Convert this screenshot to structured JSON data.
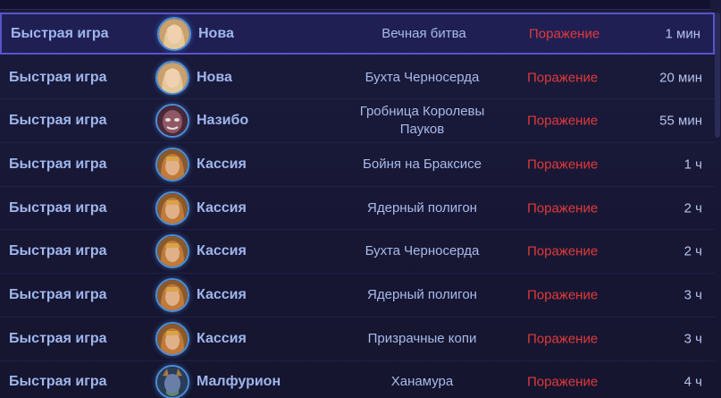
{
  "history": [
    {
      "mode": "Быстрая игра",
      "hero": "Нова",
      "hero_icon": "nova-portrait-icon",
      "map_line1": "Вечная битва",
      "map_line2": "",
      "result": "Поражение",
      "time": "1 мин"
    },
    {
      "mode": "Быстрая игра",
      "hero": "Нова",
      "hero_icon": "nova-portrait-icon",
      "map_line1": "Бухта Черносерда",
      "map_line2": "",
      "result": "Поражение",
      "time": "20 мин"
    },
    {
      "mode": "Быстрая игра",
      "hero": "Назибо",
      "hero_icon": "nazeebo-portrait-icon",
      "map_line1": "Гробница Королевы",
      "map_line2": "Пауков",
      "result": "Поражение",
      "time": "55 мин"
    },
    {
      "mode": "Быстрая игра",
      "hero": "Кассия",
      "hero_icon": "cassia-portrait-icon",
      "map_line1": "Бойня на Браксисе",
      "map_line2": "",
      "result": "Поражение",
      "time": "1 ч"
    },
    {
      "mode": "Быстрая игра",
      "hero": "Кассия",
      "hero_icon": "cassia-portrait-icon",
      "map_line1": "Ядерный полигон",
      "map_line2": "",
      "result": "Поражение",
      "time": "2 ч"
    },
    {
      "mode": "Быстрая игра",
      "hero": "Кассия",
      "hero_icon": "cassia-portrait-icon",
      "map_line1": "Бухта Черносерда",
      "map_line2": "",
      "result": "Поражение",
      "time": "2 ч"
    },
    {
      "mode": "Быстрая игра",
      "hero": "Кассия",
      "hero_icon": "cassia-portrait-icon",
      "map_line1": "Ядерный полигон",
      "map_line2": "",
      "result": "Поражение",
      "time": "3 ч"
    },
    {
      "mode": "Быстрая игра",
      "hero": "Кассия",
      "hero_icon": "cassia-portrait-icon",
      "map_line1": "Призрачные копи",
      "map_line2": "",
      "result": "Поражение",
      "time": "3 ч"
    },
    {
      "mode": "Быстрая игра",
      "hero": "Малфурион",
      "hero_icon": "malfurion-portrait-icon",
      "map_line1": "Ханамура",
      "map_line2": "",
      "result": "Поражение",
      "time": "4 ч"
    }
  ],
  "colors": {
    "accent": "#5a54c8",
    "loss": "#e13a3a",
    "text": "#9fb6ec"
  }
}
